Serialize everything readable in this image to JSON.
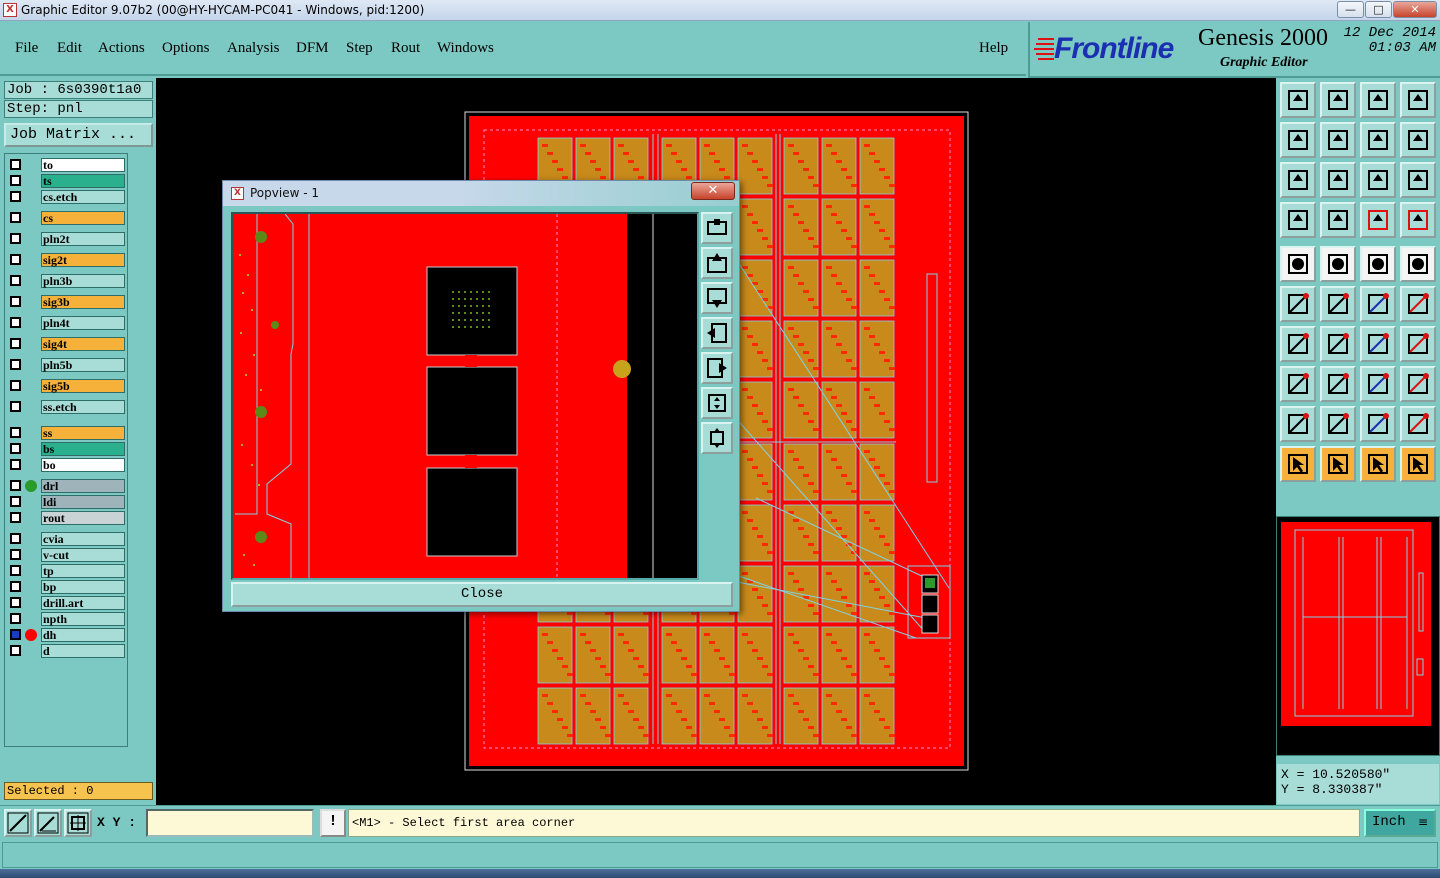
{
  "window": {
    "title": "Graphic Editor 9.07b2 (00@HY-HYCAM-PC041 - Windows, pid:1200)",
    "app_icon": "X",
    "minimize": "—",
    "maximize": "□",
    "close": "✕"
  },
  "menu": {
    "items": [
      "File",
      "Edit",
      "Actions",
      "Options",
      "Analysis",
      "DFM",
      "Step",
      "Rout",
      "Windows"
    ],
    "help": "Help"
  },
  "brand": {
    "logo": "Frontline",
    "product": "Genesis 2000",
    "subtitle": "Graphic Editor",
    "date": "12 Dec 2014",
    "time": "01:03 AM"
  },
  "job": {
    "job_label": "Job : 6s0390t1a0",
    "step_label": "Step: pnl",
    "matrix_button": "Job Matrix ..."
  },
  "layers": [
    {
      "name": "to",
      "color": "#ffffff"
    },
    {
      "name": "ts",
      "color": "#2bb08e"
    },
    {
      "name": "cs.etch",
      "color": "#a8dcd7"
    },
    {
      "name": "cs",
      "color": "#f6b13a"
    },
    {
      "name": "pln2t",
      "color": "#a8dcd7"
    },
    {
      "name": "sig2t",
      "color": "#f6b13a"
    },
    {
      "name": "pln3b",
      "color": "#a8dcd7"
    },
    {
      "name": "sig3b",
      "color": "#f6b13a"
    },
    {
      "name": "pln4t",
      "color": "#a8dcd7"
    },
    {
      "name": "sig4t",
      "color": "#f6b13a"
    },
    {
      "name": "pln5b",
      "color": "#a8dcd7"
    },
    {
      "name": "sig5b",
      "color": "#f6b13a"
    },
    {
      "name": "ss.etch",
      "color": "#a8dcd7"
    },
    {
      "name": "ss",
      "color": "#f6b13a"
    },
    {
      "name": "bs",
      "color": "#2bb08e"
    },
    {
      "name": "bo",
      "color": "#ffffff"
    },
    {
      "name": "drl",
      "color": "#9fb3ba"
    },
    {
      "name": "ldi",
      "color": "#9fb3ba"
    },
    {
      "name": "rout",
      "color": "#c9d3d6"
    },
    {
      "name": "cvia",
      "color": "#a8dcd7"
    },
    {
      "name": "v-cut",
      "color": "#a8dcd7"
    },
    {
      "name": "tp",
      "color": "#a8dcd7"
    },
    {
      "name": "bp",
      "color": "#a8dcd7"
    },
    {
      "name": "drill.art",
      "color": "#a8dcd7"
    },
    {
      "name": "npth",
      "color": "#a8dcd7"
    },
    {
      "name": "dh",
      "color": "#a8dcd7"
    },
    {
      "name": "d",
      "color": "#a8dcd7"
    }
  ],
  "selected_label": "Selected : 0",
  "popview": {
    "title": "Popview - 1",
    "close_x": "✕",
    "close_button": "Close"
  },
  "bottom": {
    "xy_label": "X Y :",
    "xy_value": "",
    "exclaim": "!",
    "prompt": "<M1> - Select first area corner",
    "unit": "Inch"
  },
  "coords": {
    "x": "X = 10.520580\"",
    "y": "Y = 8.330387\""
  }
}
